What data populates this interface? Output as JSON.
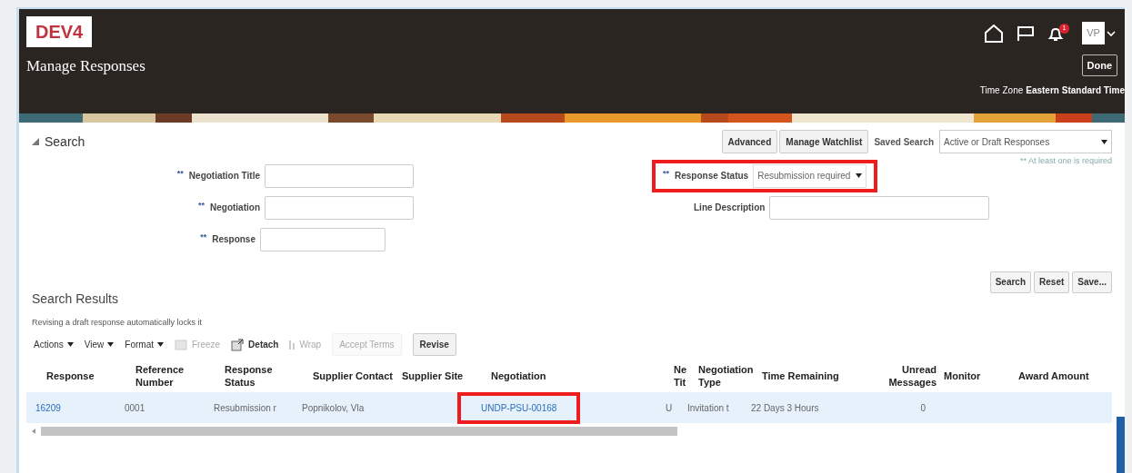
{
  "header": {
    "env_badge": "DEV4",
    "title": "Manage Responses",
    "notification_count": "1",
    "avatar": "VP",
    "done_button": "Done",
    "time_zone_label": "Time Zone",
    "time_zone": "Eastern Standard Time"
  },
  "search": {
    "title": "Search",
    "expanded": true,
    "buttons": [
      "Advanced",
      "Manage Watchlist"
    ],
    "saved_search_label": "Saved Search",
    "saved_search": "Active or Draft Responses",
    "required_note": "** At least one is required",
    "left_fields": [
      {
        "marker": "**",
        "label": "Negotiation Title",
        "kind": "text",
        "highlighted": false
      },
      {
        "marker": "**",
        "label": "Negotiation",
        "kind": "text",
        "highlighted": false
      },
      {
        "marker": "**",
        "label": "Response",
        "kind": "short",
        "highlighted": false
      }
    ],
    "right_fields": [
      {
        "marker": "**",
        "label": "Response Status",
        "kind": "select",
        "value": "Resubmission required",
        "highlighted": true
      },
      {
        "label": "Line Description",
        "kind": "text",
        "highlighted": false
      }
    ],
    "actions": [
      "Search",
      "Reset",
      "Save..."
    ]
  },
  "results": {
    "title": "Search Results",
    "note": "Revising a draft response automatically locks it",
    "toolbar": [
      {
        "label": "Actions",
        "kind": "menu",
        "disabled": false
      },
      {
        "label": "View",
        "kind": "menu",
        "disabled": false
      },
      {
        "label": "Format",
        "kind": "menu",
        "disabled": false
      },
      {
        "label": "Freeze",
        "kind": "freeze",
        "disabled": true
      },
      {
        "label": "Detach",
        "kind": "detach",
        "disabled": false
      },
      {
        "label": "Wrap",
        "kind": "wrap",
        "disabled": true
      },
      {
        "label": "Accept Terms",
        "kind": "button",
        "disabled": true
      },
      {
        "label": "Revise",
        "kind": "button",
        "disabled": false
      }
    ],
    "columns": [
      {
        "label": "Response"
      },
      {
        "label": "Reference Number"
      },
      {
        "label": "Response Status"
      },
      {
        "label": "Supplier Contact"
      },
      {
        "label": "Supplier Site"
      },
      {
        "label": "Negotiation"
      },
      {
        "label": "Ne Tit"
      },
      {
        "label": "Negotiation Type"
      },
      {
        "label": "Time Remaining"
      },
      {
        "label": "Unread Messages",
        "numeric": true
      },
      {
        "label": "Monitor"
      },
      {
        "label": "Award Amount"
      }
    ],
    "rows": [
      {
        "selected": true,
        "cells": [
          {
            "text": "16209",
            "link": true
          },
          {
            "text": "0001"
          },
          {
            "text": "Resubmission r"
          },
          {
            "text": "Popnikolov, Vla"
          },
          null,
          {
            "text": "UNDP-PSU-00168",
            "link": true,
            "highlighted": true
          },
          {
            "text": "U"
          },
          {
            "text": "Invitation t"
          },
          {
            "text": "22 Days 3 Hours"
          },
          {
            "text": "0"
          }
        ]
      }
    ]
  }
}
